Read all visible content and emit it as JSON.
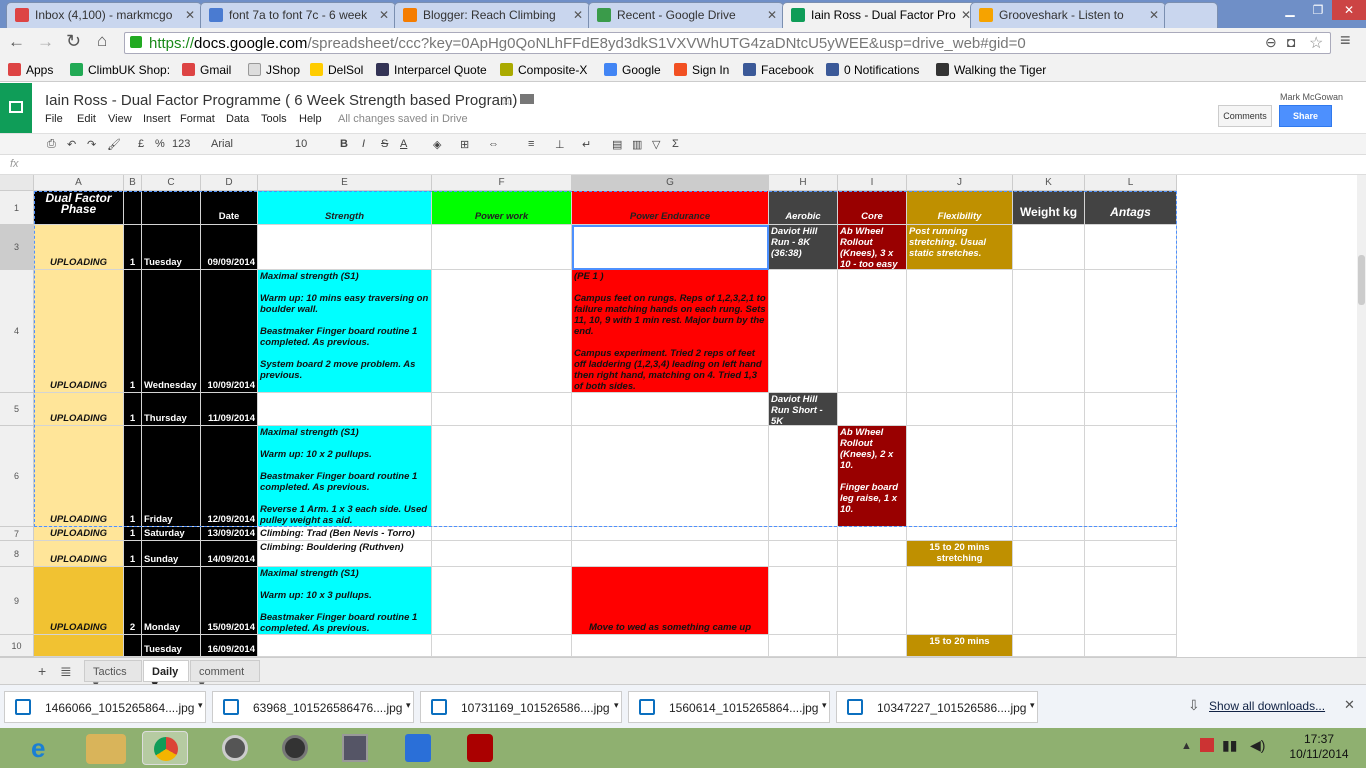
{
  "browser": {
    "tabs": [
      {
        "label": "Inbox (4,100) - markmcgo",
        "icon": "gmail-icon",
        "color": "#d44"
      },
      {
        "label": "font 7a to font 7c - 6 week",
        "icon": "docs-icon",
        "color": "#4a7bd1"
      },
      {
        "label": "Blogger: Reach Climbing",
        "icon": "blogger-icon",
        "color": "#f57d00"
      },
      {
        "label": "Recent - Google Drive",
        "icon": "drive-icon",
        "color": "#3a9b4a"
      },
      {
        "label": "Iain Ross - Dual Factor Pro",
        "icon": "sheets-icon",
        "color": "#0f9d58"
      },
      {
        "label": "Grooveshark - Listen to",
        "icon": "grooveshark-icon",
        "color": "#f6a300"
      }
    ],
    "url_prefix": "https://",
    "url_host": "docs.google.com",
    "url_rest": "/spreadsheet/ccc?key=0ApHg0QoNLhFFdE8yd3dkS1VXVWhUTG4zaDNtcU5yWEE&usp=drive_web#gid=0",
    "bookmarks": [
      {
        "label": "Apps",
        "icon": "apps-icon",
        "color": "#d44"
      },
      {
        "label": "ClimbUK Shop:",
        "icon": "climbuk-icon",
        "color": "#2a5"
      },
      {
        "label": "Gmail",
        "icon": "gmail-icon",
        "color": "#d44"
      },
      {
        "label": "JShop",
        "icon": "page-icon",
        "color": "#ddd"
      },
      {
        "label": "DelSol",
        "icon": "delsol-icon",
        "color": "#fc0"
      },
      {
        "label": "Interparcel Quote",
        "icon": "interparcel-icon",
        "color": "#335"
      },
      {
        "label": "Composite-X",
        "icon": "composite-icon",
        "color": "#aa0"
      },
      {
        "label": "Google",
        "icon": "google-icon",
        "color": "#4285f4"
      },
      {
        "label": "Sign In",
        "icon": "windows-icon",
        "color": "#f25022"
      },
      {
        "label": "Facebook",
        "icon": "facebook-icon",
        "color": "#3b5998"
      },
      {
        "label": "0 Notifications",
        "icon": "facebook-icon",
        "color": "#3b5998"
      },
      {
        "label": "Walking the Tiger",
        "icon": "tiger-icon",
        "color": "#333"
      }
    ]
  },
  "sheet": {
    "title": "Iain Ross - Dual Factor Programme ( 6 Week Strength based Program)",
    "user": "Mark McGowan",
    "comments_label": "Comments",
    "share_label": "Share",
    "menus": [
      "File",
      "Edit",
      "View",
      "Insert",
      "Format",
      "Data",
      "Tools",
      "Help"
    ],
    "save_status": "All changes saved in Drive",
    "toolbar": {
      "currency": "£",
      "percent": "%",
      "numfmt": "123",
      "font": "Arial",
      "size": "10",
      "bold": "B",
      "italic": "I",
      "strike": "S",
      "color": "A",
      "sigma": "Σ"
    },
    "fx_label": "fx"
  },
  "columns": [
    "A",
    "B",
    "C",
    "D",
    "E",
    "F",
    "G",
    "H",
    "I",
    "J",
    "K",
    "L"
  ],
  "row_numbers": [
    "1",
    "3",
    "4",
    "5",
    "6",
    "7",
    "8",
    "9",
    "10"
  ],
  "header_row": {
    "phase": "Dual Factor Phase",
    "date": "Date",
    "strength": "Strength",
    "power": "Power work",
    "power_endurance": "Power Endurance",
    "aerobic": "Aerobic",
    "core": "Core",
    "flexibility": "Flexibility",
    "weight": "Weight kg",
    "antags": "Antags"
  },
  "rows": [
    {
      "phase": "UPLOADING",
      "week": "1",
      "day": "Tuesday",
      "date": "09/09/2014",
      "strength": "",
      "power_endurance": "",
      "aerobic": "Daviot Hill Run - 8K (36:38)",
      "core": "Ab Wheel Rollout (Knees), 3 x 10 - too easy",
      "flexibility": "Post running stretching. Usual static stretches."
    },
    {
      "phase": "UPLOADING",
      "week": "1",
      "day": "Wednesday",
      "date": "10/09/2014",
      "strength": "Maximal strength (S1)\n\nWarm up: 10 mins easy traversing on boulder wall.\n\nBeastmaker Finger board routine 1 completed. As previous.\n\nSystem board 2 move problem. As previous.",
      "power_endurance": "(PE 1 )\n\nCampus feet on rungs. Reps of 1,2,3,2,1 to failure matching hands on each rung. Sets 11, 10, 9 with 1 min rest. Major burn by the end.\n\nCampus experiment. Tried 2 reps of feet off laddering (1,2,3,4) leading on left hand then right hand, matching on 4. Tried 1,3 of both sides.",
      "aerobic": "",
      "core": "",
      "flexibility": ""
    },
    {
      "phase": "UPLOADING",
      "week": "1",
      "day": "Thursday",
      "date": "11/09/2014",
      "strength": "",
      "power_endurance": "",
      "aerobic": "Daviot Hill Run Short - 5K",
      "core": "",
      "flexibility": ""
    },
    {
      "phase": "UPLOADING",
      "week": "1",
      "day": "Friday",
      "date": "12/09/2014",
      "strength": "Maximal strength (S1)\n\nWarm up: 10 x 2 pullups.\n\nBeastmaker Finger board routine 1 completed. As previous.\n\nReverse 1 Arm. 1 x 3 each side. Used pulley weight as aid.",
      "power_endurance": "",
      "aerobic": "",
      "core": "Ab Wheel Rollout (Knees), 2 x 10.\n\nFinger board leg raise, 1 x 10.",
      "flexibility": ""
    },
    {
      "phase": "UPLOADING",
      "week": "1",
      "day": "Saturday",
      "date": "13/09/2014",
      "strength": "Climbing: Trad (Ben Nevis - Torro)",
      "power_endurance": "",
      "aerobic": "",
      "core": "",
      "flexibility": ""
    },
    {
      "phase": "UPLOADING",
      "week": "1",
      "day": "Sunday",
      "date": "14/09/2014",
      "strength": "Climbing: Bouldering (Ruthven)",
      "power_endurance": "",
      "aerobic": "",
      "core": "",
      "flexibility": "15 to 20 mins stretching"
    },
    {
      "phase": "UPLOADING",
      "week": "2",
      "day": "Monday",
      "date": "15/09/2014",
      "strength": "Maximal strength (S1)\n\nWarm up: 10 x 3 pullups.\n\nBeastmaker Finger board routine 1 completed. As previous.",
      "power_endurance": "Move to wed as something came up",
      "aerobic": "",
      "core": "",
      "flexibility": ""
    },
    {
      "phase": "",
      "week": "",
      "day": "Tuesday",
      "date": "16/09/2014",
      "strength": "",
      "power_endurance": "",
      "aerobic": "",
      "core": "",
      "flexibility": "15 to 20 mins"
    }
  ],
  "sheet_tabs": [
    "Tactics",
    "Daily",
    "comment"
  ],
  "downloads": [
    "1466066_1015265864....jpg",
    "63968_1015265864​76....jpg",
    "10731169_101526586....jpg",
    "1560614_1015265864....jpg",
    "10347227_101526586....jpg"
  ],
  "show_all_downloads": "Show all downloads...",
  "clock": {
    "time": "17:37",
    "date": "10/11/2014"
  },
  "colors": {
    "phase_light": "#ffe599",
    "phase_dark": "#f1c232",
    "black": "#000000",
    "strength": "#00ffff",
    "power": "#00ff00",
    "power_endurance": "#ff0000",
    "aerobic": "#434343",
    "core": "#990000",
    "flexibility": "#bf9000"
  }
}
